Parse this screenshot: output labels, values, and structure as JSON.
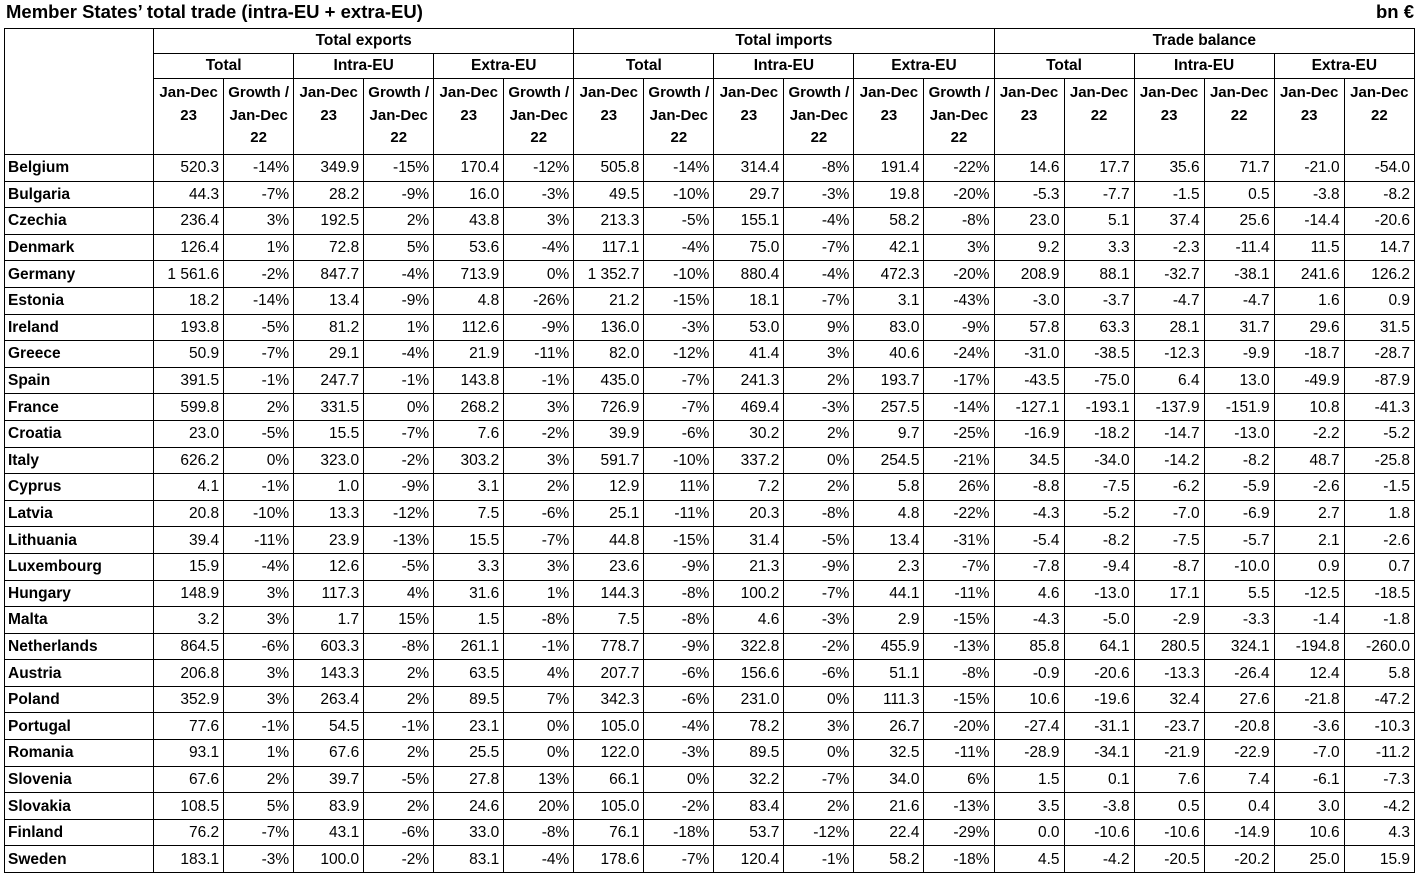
{
  "title": "Member States’ total trade (intra-EU + extra-EU)",
  "unit": "bn €",
  "groups": {
    "exports": "Total exports",
    "imports": "Total imports",
    "balance": "Trade balance"
  },
  "subgroups": {
    "total": "Total",
    "intra": "Intra-EU",
    "extra": "Extra-EU"
  },
  "colheads": {
    "jan23": "Jan-Dec 23",
    "growth": "Growth / Jan-Dec 22",
    "jan22": "Jan-Dec 22"
  },
  "rows": [
    [
      "Belgium",
      "520.3",
      "-14%",
      "349.9",
      "-15%",
      "170.4",
      "-12%",
      "505.8",
      "-14%",
      "314.4",
      "-8%",
      "191.4",
      "-22%",
      "14.6",
      "17.7",
      "35.6",
      "71.7",
      "-21.0",
      "-54.0"
    ],
    [
      "Bulgaria",
      "44.3",
      "-7%",
      "28.2",
      "-9%",
      "16.0",
      "-3%",
      "49.5",
      "-10%",
      "29.7",
      "-3%",
      "19.8",
      "-20%",
      "-5.3",
      "-7.7",
      "-1.5",
      "0.5",
      "-3.8",
      "-8.2"
    ],
    [
      "Czechia",
      "236.4",
      "3%",
      "192.5",
      "2%",
      "43.8",
      "3%",
      "213.3",
      "-5%",
      "155.1",
      "-4%",
      "58.2",
      "-8%",
      "23.0",
      "5.1",
      "37.4",
      "25.6",
      "-14.4",
      "-20.6"
    ],
    [
      "Denmark",
      "126.4",
      "1%",
      "72.8",
      "5%",
      "53.6",
      "-4%",
      "117.1",
      "-4%",
      "75.0",
      "-7%",
      "42.1",
      "3%",
      "9.2",
      "3.3",
      "-2.3",
      "-11.4",
      "11.5",
      "14.7"
    ],
    [
      "Germany",
      "1 561.6",
      "-2%",
      "847.7",
      "-4%",
      "713.9",
      "0%",
      "1 352.7",
      "-10%",
      "880.4",
      "-4%",
      "472.3",
      "-20%",
      "208.9",
      "88.1",
      "-32.7",
      "-38.1",
      "241.6",
      "126.2"
    ],
    [
      "Estonia",
      "18.2",
      "-14%",
      "13.4",
      "-9%",
      "4.8",
      "-26%",
      "21.2",
      "-15%",
      "18.1",
      "-7%",
      "3.1",
      "-43%",
      "-3.0",
      "-3.7",
      "-4.7",
      "-4.7",
      "1.6",
      "0.9"
    ],
    [
      "Ireland",
      "193.8",
      "-5%",
      "81.2",
      "1%",
      "112.6",
      "-9%",
      "136.0",
      "-3%",
      "53.0",
      "9%",
      "83.0",
      "-9%",
      "57.8",
      "63.3",
      "28.1",
      "31.7",
      "29.6",
      "31.5"
    ],
    [
      "Greece",
      "50.9",
      "-7%",
      "29.1",
      "-4%",
      "21.9",
      "-11%",
      "82.0",
      "-12%",
      "41.4",
      "3%",
      "40.6",
      "-24%",
      "-31.0",
      "-38.5",
      "-12.3",
      "-9.9",
      "-18.7",
      "-28.7"
    ],
    [
      "Spain",
      "391.5",
      "-1%",
      "247.7",
      "-1%",
      "143.8",
      "-1%",
      "435.0",
      "-7%",
      "241.3",
      "2%",
      "193.7",
      "-17%",
      "-43.5",
      "-75.0",
      "6.4",
      "13.0",
      "-49.9",
      "-87.9"
    ],
    [
      "France",
      "599.8",
      "2%",
      "331.5",
      "0%",
      "268.2",
      "3%",
      "726.9",
      "-7%",
      "469.4",
      "-3%",
      "257.5",
      "-14%",
      "-127.1",
      "-193.1",
      "-137.9",
      "-151.9",
      "10.8",
      "-41.3"
    ],
    [
      "Croatia",
      "23.0",
      "-5%",
      "15.5",
      "-7%",
      "7.6",
      "-2%",
      "39.9",
      "-6%",
      "30.2",
      "2%",
      "9.7",
      "-25%",
      "-16.9",
      "-18.2",
      "-14.7",
      "-13.0",
      "-2.2",
      "-5.2"
    ],
    [
      "Italy",
      "626.2",
      "0%",
      "323.0",
      "-2%",
      "303.2",
      "3%",
      "591.7",
      "-10%",
      "337.2",
      "0%",
      "254.5",
      "-21%",
      "34.5",
      "-34.0",
      "-14.2",
      "-8.2",
      "48.7",
      "-25.8"
    ],
    [
      "Cyprus",
      "4.1",
      "-1%",
      "1.0",
      "-9%",
      "3.1",
      "2%",
      "12.9",
      "11%",
      "7.2",
      "2%",
      "5.8",
      "26%",
      "-8.8",
      "-7.5",
      "-6.2",
      "-5.9",
      "-2.6",
      "-1.5"
    ],
    [
      "Latvia",
      "20.8",
      "-10%",
      "13.3",
      "-12%",
      "7.5",
      "-6%",
      "25.1",
      "-11%",
      "20.3",
      "-8%",
      "4.8",
      "-22%",
      "-4.3",
      "-5.2",
      "-7.0",
      "-6.9",
      "2.7",
      "1.8"
    ],
    [
      "Lithuania",
      "39.4",
      "-11%",
      "23.9",
      "-13%",
      "15.5",
      "-7%",
      "44.8",
      "-15%",
      "31.4",
      "-5%",
      "13.4",
      "-31%",
      "-5.4",
      "-8.2",
      "-7.5",
      "-5.7",
      "2.1",
      "-2.6"
    ],
    [
      "Luxembourg",
      "15.9",
      "-4%",
      "12.6",
      "-5%",
      "3.3",
      "3%",
      "23.6",
      "-9%",
      "21.3",
      "-9%",
      "2.3",
      "-7%",
      "-7.8",
      "-9.4",
      "-8.7",
      "-10.0",
      "0.9",
      "0.7"
    ],
    [
      "Hungary",
      "148.9",
      "3%",
      "117.3",
      "4%",
      "31.6",
      "1%",
      "144.3",
      "-8%",
      "100.2",
      "-7%",
      "44.1",
      "-11%",
      "4.6",
      "-13.0",
      "17.1",
      "5.5",
      "-12.5",
      "-18.5"
    ],
    [
      "Malta",
      "3.2",
      "3%",
      "1.7",
      "15%",
      "1.5",
      "-8%",
      "7.5",
      "-8%",
      "4.6",
      "-3%",
      "2.9",
      "-15%",
      "-4.3",
      "-5.0",
      "-2.9",
      "-3.3",
      "-1.4",
      "-1.8"
    ],
    [
      "Netherlands",
      "864.5",
      "-6%",
      "603.3",
      "-8%",
      "261.1",
      "-1%",
      "778.7",
      "-9%",
      "322.8",
      "-2%",
      "455.9",
      "-13%",
      "85.8",
      "64.1",
      "280.5",
      "324.1",
      "-194.8",
      "-260.0"
    ],
    [
      "Austria",
      "206.8",
      "3%",
      "143.3",
      "2%",
      "63.5",
      "4%",
      "207.7",
      "-6%",
      "156.6",
      "-6%",
      "51.1",
      "-8%",
      "-0.9",
      "-20.6",
      "-13.3",
      "-26.4",
      "12.4",
      "5.8"
    ],
    [
      "Poland",
      "352.9",
      "3%",
      "263.4",
      "2%",
      "89.5",
      "7%",
      "342.3",
      "-6%",
      "231.0",
      "0%",
      "111.3",
      "-15%",
      "10.6",
      "-19.6",
      "32.4",
      "27.6",
      "-21.8",
      "-47.2"
    ],
    [
      "Portugal",
      "77.6",
      "-1%",
      "54.5",
      "-1%",
      "23.1",
      "0%",
      "105.0",
      "-4%",
      "78.2",
      "3%",
      "26.7",
      "-20%",
      "-27.4",
      "-31.1",
      "-23.7",
      "-20.8",
      "-3.6",
      "-10.3"
    ],
    [
      "Romania",
      "93.1",
      "1%",
      "67.6",
      "2%",
      "25.5",
      "0%",
      "122.0",
      "-3%",
      "89.5",
      "0%",
      "32.5",
      "-11%",
      "-28.9",
      "-34.1",
      "-21.9",
      "-22.9",
      "-7.0",
      "-11.2"
    ],
    [
      "Slovenia",
      "67.6",
      "2%",
      "39.7",
      "-5%",
      "27.8",
      "13%",
      "66.1",
      "0%",
      "32.2",
      "-7%",
      "34.0",
      "6%",
      "1.5",
      "0.1",
      "7.6",
      "7.4",
      "-6.1",
      "-7.3"
    ],
    [
      "Slovakia",
      "108.5",
      "5%",
      "83.9",
      "2%",
      "24.6",
      "20%",
      "105.0",
      "-2%",
      "83.4",
      "2%",
      "21.6",
      "-13%",
      "3.5",
      "-3.8",
      "0.5",
      "0.4",
      "3.0",
      "-4.2"
    ],
    [
      "Finland",
      "76.2",
      "-7%",
      "43.1",
      "-6%",
      "33.0",
      "-8%",
      "76.1",
      "-18%",
      "53.7",
      "-12%",
      "22.4",
      "-29%",
      "0.0",
      "-10.6",
      "-10.6",
      "-14.9",
      "10.6",
      "4.3"
    ],
    [
      "Sweden",
      "183.1",
      "-3%",
      "100.0",
      "-2%",
      "83.1",
      "-4%",
      "178.6",
      "-7%",
      "120.4",
      "-1%",
      "58.2",
      "-18%",
      "4.5",
      "-4.2",
      "-20.5",
      "-20.2",
      "25.0",
      "15.9"
    ]
  ]
}
